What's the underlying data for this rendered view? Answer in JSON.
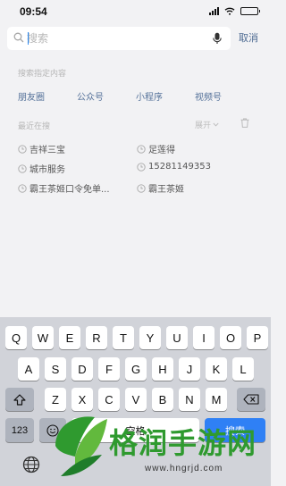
{
  "status_bar": {
    "time": "09:54"
  },
  "search": {
    "placeholder": "搜索",
    "cancel_label": "取消"
  },
  "filters": {
    "title": "搜索指定内容",
    "items": [
      "朋友圈",
      "公众号",
      "小程序",
      "视频号"
    ]
  },
  "recent": {
    "title": "最近在搜",
    "expand_label": "展开",
    "items": [
      "吉祥三宝",
      "足莲得",
      "城市服务",
      "15281149353",
      "霸王茶姬口令免单...",
      "霸王茶姬"
    ]
  },
  "keyboard": {
    "row1": [
      "Q",
      "W",
      "E",
      "R",
      "T",
      "Y",
      "U",
      "I",
      "O",
      "P"
    ],
    "row2": [
      "A",
      "S",
      "D",
      "F",
      "G",
      "H",
      "J",
      "K",
      "L"
    ],
    "row3": [
      "Z",
      "X",
      "C",
      "V",
      "B",
      "N",
      "M"
    ],
    "numbers_key": "123",
    "space_label": "空格",
    "search_key": "搜索"
  },
  "watermark": {
    "text": "格润手游网",
    "url": "www.hngrjd.com"
  },
  "colors": {
    "link": "#55729a",
    "accent": "#2f80f5",
    "keyboard_bg": "#d1d3d9",
    "watermark_green": "#2f9a2f"
  }
}
